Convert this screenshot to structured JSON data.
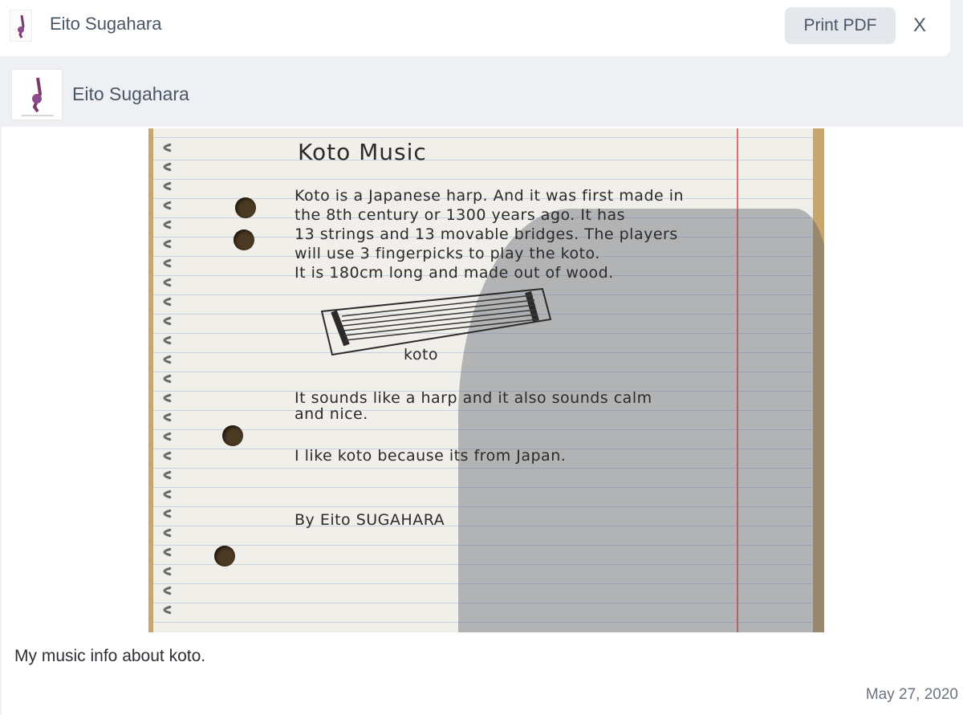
{
  "header": {
    "title": "Eito Sugahara",
    "print_label": "Print PDF",
    "close_label": "X"
  },
  "author": {
    "name": "Eito Sugahara"
  },
  "post": {
    "image": {
      "title": "Koto Music",
      "lines": [
        "Koto is a Japanese harp. And it was first made in",
        "the 8th century or 1300 years ago.   It has",
        "13 strings and 13 movable bridges.   The players",
        "will use 3 fingerpicks to play the koto.",
        "It is 180cm long and made out of wood."
      ],
      "drawing_label": "koto",
      "line2": [
        "It sounds like a harp and it also sounds calm",
        "and nice."
      ],
      "line3": "I like koto because its from Japan.",
      "signature": "By Eito SUGAHARA"
    },
    "caption": "My music info about koto.",
    "date": "May 27, 2020"
  },
  "colors": {
    "page_bg": "#eef0f3",
    "button_bg": "#e4e8ec",
    "text": "#4a5666",
    "paper_margin": "#e86a6a"
  },
  "icons": {
    "close": "close-icon"
  }
}
